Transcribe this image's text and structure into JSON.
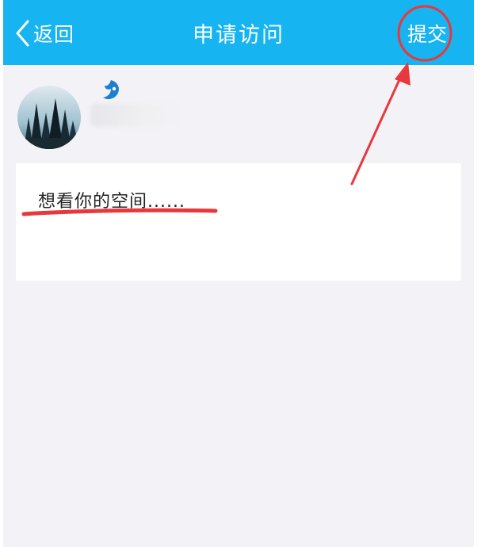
{
  "header": {
    "back_label": "返回",
    "title": "申请访问",
    "submit_label": "提交"
  },
  "message": {
    "text": "想看你的空间......"
  },
  "colors": {
    "header_bg": "#16b4f0",
    "page_bg": "#f3f3f7",
    "card_bg": "#ffffff",
    "annotation_red": "#e8383d",
    "vip_blue": "#1f7fcf"
  },
  "icons": {
    "back": "chevron-left-icon",
    "vip": "vip-badge-icon",
    "avatar": "avatar-forest-image"
  }
}
